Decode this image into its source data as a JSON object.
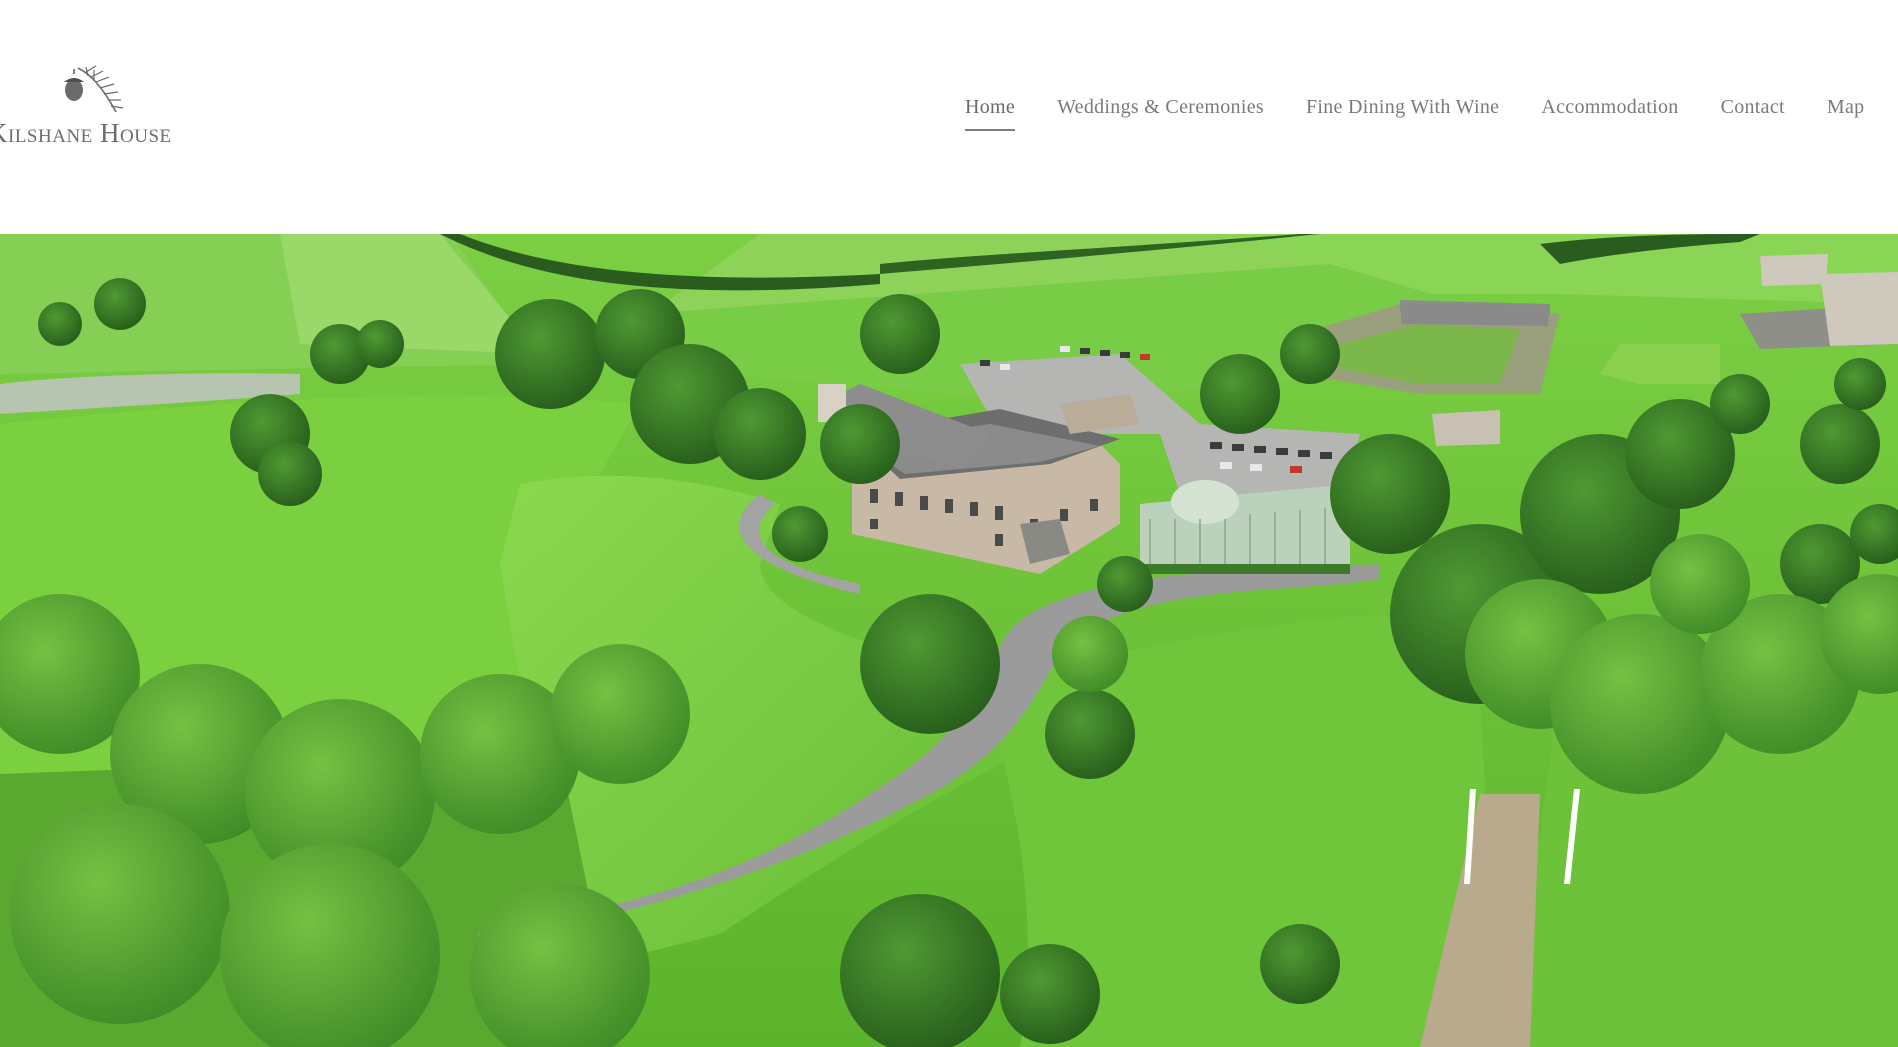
{
  "site": {
    "logo_text": "Kilshane House",
    "logo_icon": "acorn-branch-icon"
  },
  "nav": {
    "items": [
      {
        "label": "Home",
        "active": true
      },
      {
        "label": "Weddings & Ceremonies",
        "active": false
      },
      {
        "label": "Fine Dining With Wine",
        "active": false
      },
      {
        "label": "Accommodation",
        "active": false
      },
      {
        "label": "Contact",
        "active": false
      },
      {
        "label": "Map",
        "active": false
      }
    ]
  },
  "hero": {
    "image": "aerial-estate-photo"
  },
  "colors": {
    "nav_text": "#7a7a7a",
    "logo_text": "#6d6d6d",
    "grass_light": "#7fd04a",
    "grass_mid": "#5fb232",
    "tree_dark": "#2f6b22",
    "road": "#9a9a9a"
  }
}
